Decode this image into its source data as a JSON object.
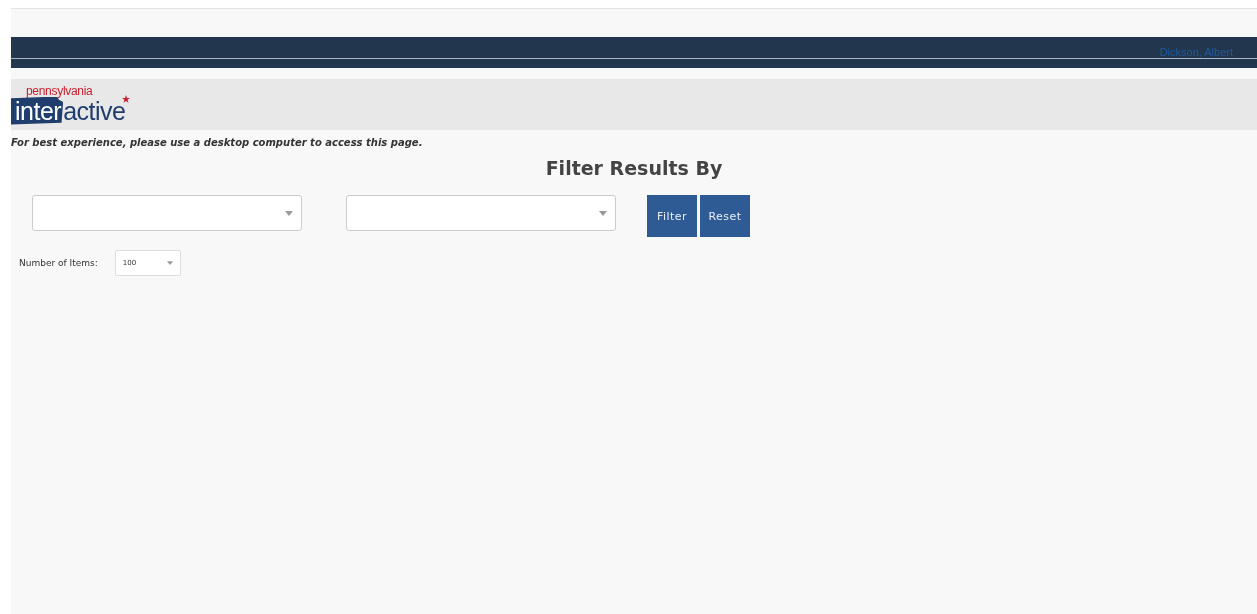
{
  "top_bar": {
    "user": "Dickson, Albert"
  },
  "logo": {
    "state": "pennsylvania",
    "word_left": "inter",
    "word_right": "active"
  },
  "notice": "For best experience, please use a desktop computer to access this page.",
  "filter": {
    "title": "Filter Results By",
    "dropdowns": [
      {
        "kind": "select"
      },
      {
        "kind": "select"
      }
    ],
    "buttons": [
      "Filter",
      "Reset"
    ]
  },
  "items_per_page": {
    "label": "Number of Items:",
    "value": "100"
  }
}
